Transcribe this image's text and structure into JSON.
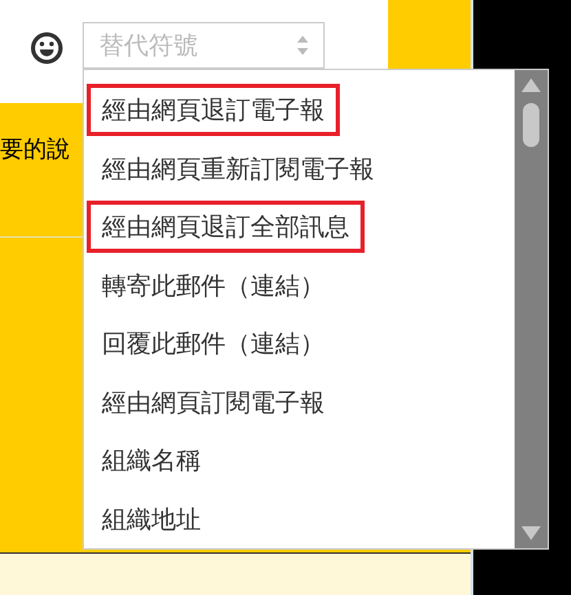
{
  "select": {
    "placeholder": "替代符號"
  },
  "background_text": "要的說",
  "dropdown": {
    "items": [
      {
        "label": "經由網頁退訂電子報",
        "highlighted": true
      },
      {
        "label": "經由網頁重新訂閱電子報",
        "highlighted": false
      },
      {
        "label": "經由網頁退訂全部訊息",
        "highlighted": true
      },
      {
        "label": "轉寄此郵件（連結）",
        "highlighted": false
      },
      {
        "label": "回覆此郵件（連結）",
        "highlighted": false
      },
      {
        "label": "經由網頁訂閱電子報",
        "highlighted": false
      },
      {
        "label": "組織名稱",
        "highlighted": false
      },
      {
        "label": "組織地址",
        "highlighted": false
      }
    ]
  }
}
